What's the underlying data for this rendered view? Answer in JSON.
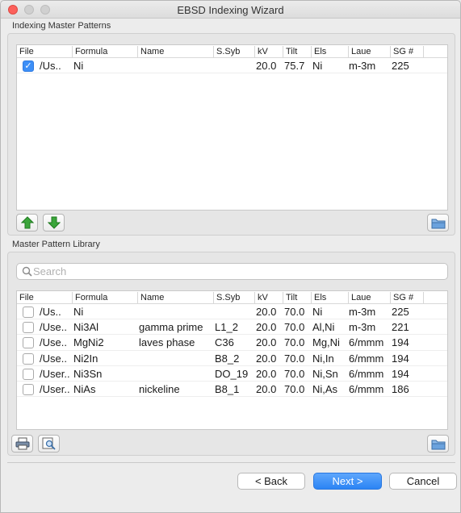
{
  "window": {
    "title": "EBSD Indexing Wizard"
  },
  "indexing": {
    "section_label": "Indexing Master Patterns",
    "columns": [
      "File",
      "Formula",
      "Name",
      "S.Syb",
      "kV",
      "Tilt",
      "Els",
      "Laue",
      "SG #"
    ],
    "rows": [
      {
        "checked": true,
        "file": "/Us..",
        "formula": "Ni",
        "name": "",
        "ssyb": "",
        "kv": "20.0",
        "tilt": "75.7",
        "els": "Ni",
        "laue": "m-3m",
        "sg": "225"
      }
    ]
  },
  "library": {
    "section_label": "Master Pattern Library",
    "search_placeholder": "Search",
    "columns": [
      "File",
      "Formula",
      "Name",
      "S.Syb",
      "kV",
      "Tilt",
      "Els",
      "Laue",
      "SG #"
    ],
    "rows": [
      {
        "checked": false,
        "file": "/Us..",
        "formula": "Ni",
        "name": "",
        "ssyb": "",
        "kv": "20.0",
        "tilt": "70.0",
        "els": "Ni",
        "laue": "m-3m",
        "sg": "225"
      },
      {
        "checked": false,
        "file": "/Use..",
        "formula": "Ni3Al",
        "name": "gamma prime",
        "ssyb": "L1_2",
        "kv": "20.0",
        "tilt": "70.0",
        "els": "Al,Ni",
        "laue": "m-3m",
        "sg": "221"
      },
      {
        "checked": false,
        "file": "/Use..",
        "formula": "MgNi2",
        "name": "laves phase",
        "ssyb": "C36",
        "kv": "20.0",
        "tilt": "70.0",
        "els": "Mg,Ni",
        "laue": "6/mmm",
        "sg": "194"
      },
      {
        "checked": false,
        "file": "/Use..",
        "formula": "Ni2In",
        "name": "",
        "ssyb": "B8_2",
        "kv": "20.0",
        "tilt": "70.0",
        "els": "Ni,In",
        "laue": "6/mmm",
        "sg": "194"
      },
      {
        "checked": false,
        "file": "/User..",
        "formula": "Ni3Sn",
        "name": "",
        "ssyb": "DO_19",
        "kv": "20.0",
        "tilt": "70.0",
        "els": "Ni,Sn",
        "laue": "6/mmm",
        "sg": "194"
      },
      {
        "checked": false,
        "file": "/User..",
        "formula": "NiAs",
        "name": "nickeline",
        "ssyb": "B8_1",
        "kv": "20.0",
        "tilt": "70.0",
        "els": "Ni,As",
        "laue": "6/mmm",
        "sg": "186"
      }
    ]
  },
  "icons": {
    "move_up": "arrow-up-icon",
    "move_down": "arrow-down-icon",
    "open_folder": "folder-icon",
    "print": "print-icon",
    "preview": "magnify-icon",
    "library_folder": "folder-icon"
  },
  "buttons": {
    "back": "< Back",
    "next": "Next >",
    "cancel": "Cancel"
  },
  "colors": {
    "accent": "#3d8ff7",
    "arrow_green": "#3aa53a"
  }
}
